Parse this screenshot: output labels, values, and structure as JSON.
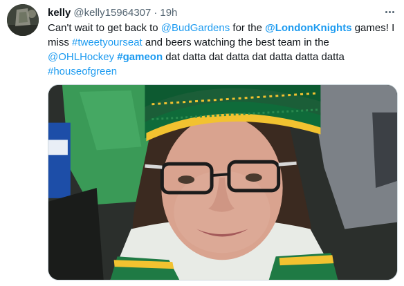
{
  "tweet": {
    "display_name": "kelly",
    "handle": "@kelly15964307",
    "separator": "·",
    "timestamp": "19h",
    "text": {
      "line1": {
        "t1": "Can't wait to get back to ",
        "m1": "@BudGardens",
        "t2": " for the ",
        "m2": "@LondonKnights",
        "t3": " games! I"
      },
      "line2": {
        "t1": "miss ",
        "h1": "#tweetyourseat",
        "t2": " and beers watching the best team in the"
      },
      "line3": {
        "m1": "@OHLHockey",
        "t1": " ",
        "h1": "#gameon",
        "t2": " dat datta dat datta dat datta datta datta"
      },
      "line4": {
        "h1": "#houseofgreen"
      }
    },
    "media_alt": "Selfie of a smiling woman with glasses wearing a green and yellow knit hockey toque at an arena",
    "colors": {
      "link": "#1d9bf0",
      "text": "#0f1419",
      "secondary": "#536471",
      "knights_green": "#0f6b3a",
      "knights_gold": "#f2c230"
    },
    "icons": {
      "more": "more-horizontal-icon"
    }
  }
}
